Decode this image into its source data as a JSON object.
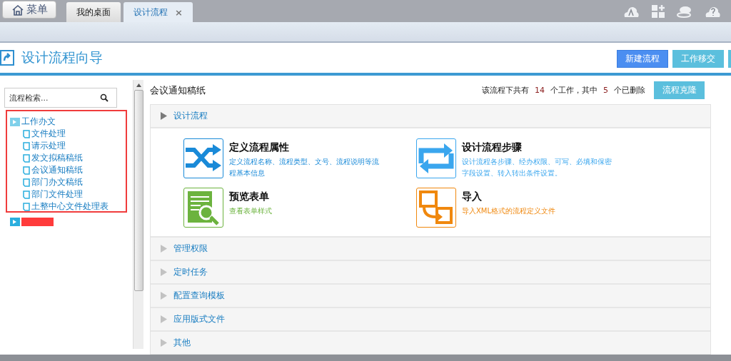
{
  "top_bar": {
    "menu_button": "菜单",
    "tabs": [
      {
        "label": "我的桌面",
        "selected": false,
        "closable": false
      },
      {
        "label": "设计流程",
        "selected": true,
        "closable": true
      }
    ],
    "close_glyph": "×"
  },
  "header": {
    "title": "设计流程向导",
    "buttons": [
      {
        "label": "新建流程",
        "kind": "primary"
      },
      {
        "label": "工作移交",
        "kind": "info"
      }
    ]
  },
  "sidebar": {
    "search": {
      "placeholder": "流程检索..."
    },
    "tree": [
      {
        "label": "工作办文",
        "expanded": true,
        "children": [
          {
            "label": "文件处理"
          },
          {
            "label": "请示处理"
          },
          {
            "label": "发文拟稿稿纸"
          },
          {
            "label": "会议通知稿纸"
          },
          {
            "label": "部门办文稿纸"
          },
          {
            "label": "部门文件处理"
          },
          {
            "label": "土整中心文件处理表"
          }
        ]
      },
      {
        "expanded": false,
        "redacted": true
      }
    ]
  },
  "main": {
    "flow_name": "会议通知稿纸",
    "stats": {
      "prefix": "该流程下共有",
      "total": "14",
      "middle": "个工作，其中",
      "deleted": "5",
      "suffix": "个已删除"
    },
    "clone_button": "流程克隆",
    "sections": [
      {
        "title": "设计流程",
        "expanded": true,
        "actions": [
          {
            "kind": "shuffle",
            "title": "定义流程属性",
            "description": "定义流程名称、流程类型、文号、流程说明等流程基本信息"
          },
          {
            "kind": "cycle",
            "title": "设计流程步骤",
            "description": "设计流程各步骤、经办权限、可写、必填和保密字段设置、转入转出条件设置。"
          },
          {
            "kind": "preview",
            "title": "预览表单",
            "description": "查看表单样式"
          },
          {
            "kind": "import",
            "title": "导入",
            "description": "导入XML格式的流程定义文件"
          }
        ]
      },
      {
        "title": "管理权限",
        "expanded": false
      },
      {
        "title": "定时任务",
        "expanded": false
      },
      {
        "title": "配置查询模板",
        "expanded": false
      },
      {
        "title": "应用版式文件",
        "expanded": false
      },
      {
        "title": "其他",
        "expanded": false
      }
    ]
  }
}
